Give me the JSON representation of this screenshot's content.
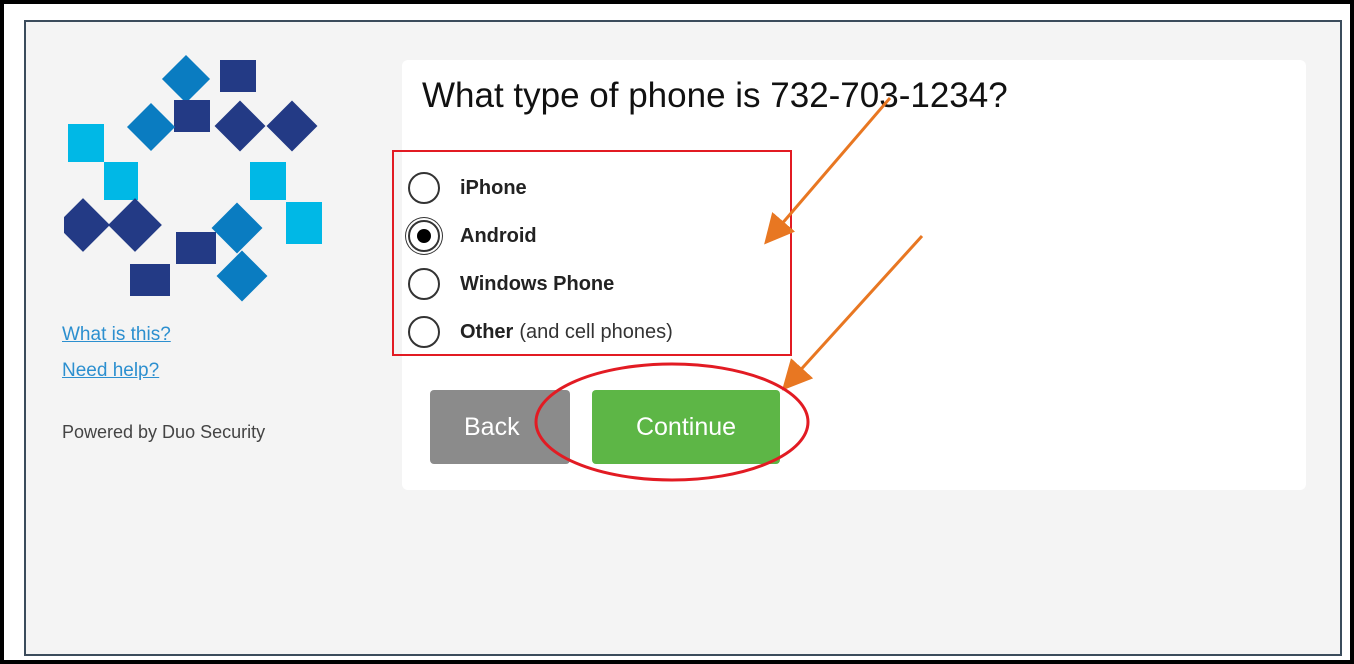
{
  "sidebar": {
    "links": [
      {
        "label": "What is this?"
      },
      {
        "label": "Need help?"
      }
    ],
    "powered_by": "Powered by Duo Security"
  },
  "prompt": {
    "question": "What type of phone is 732-703-1234?",
    "options": [
      {
        "label": "iPhone",
        "note": "",
        "selected": false
      },
      {
        "label": "Android",
        "note": "",
        "selected": true
      },
      {
        "label": "Windows Phone",
        "note": "",
        "selected": false
      },
      {
        "label": "Other",
        "note": "(and cell phones)",
        "selected": false
      }
    ],
    "back_label": "Back",
    "continue_label": "Continue"
  },
  "colors": {
    "logo_light": "#00b8e6",
    "logo_mid": "#0a7cc1",
    "logo_dark": "#233a85",
    "continue": "#5db646",
    "back": "#8b8b8b",
    "annotation_red": "#e21b23",
    "annotation_arrow": "#e87722"
  },
  "logo": {
    "name": "duo-security-logo"
  }
}
